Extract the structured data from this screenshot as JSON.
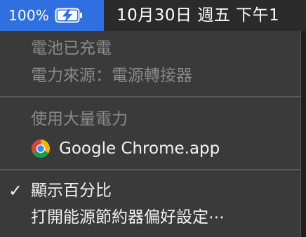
{
  "menubar": {
    "battery_percent": "100%",
    "clock": "10月30日 週五 下午1"
  },
  "menu": {
    "status_line1": "電池已充電",
    "status_line2": "電力來源：電源轉接器",
    "heavy_usage_header": "使用大量電力",
    "apps": [
      {
        "name": "Google Chrome.app",
        "icon": "chrome-icon"
      }
    ],
    "show_percentage": {
      "label": "顯示百分比",
      "checked": true
    },
    "energy_saver": "打開能源節約器偏好設定⋯"
  },
  "colors": {
    "highlight": "#2f6fe0",
    "menu_bg": "#3a3a3b",
    "disabled_text": "#8a8a8a",
    "enabled_text": "#f2f2f2"
  }
}
